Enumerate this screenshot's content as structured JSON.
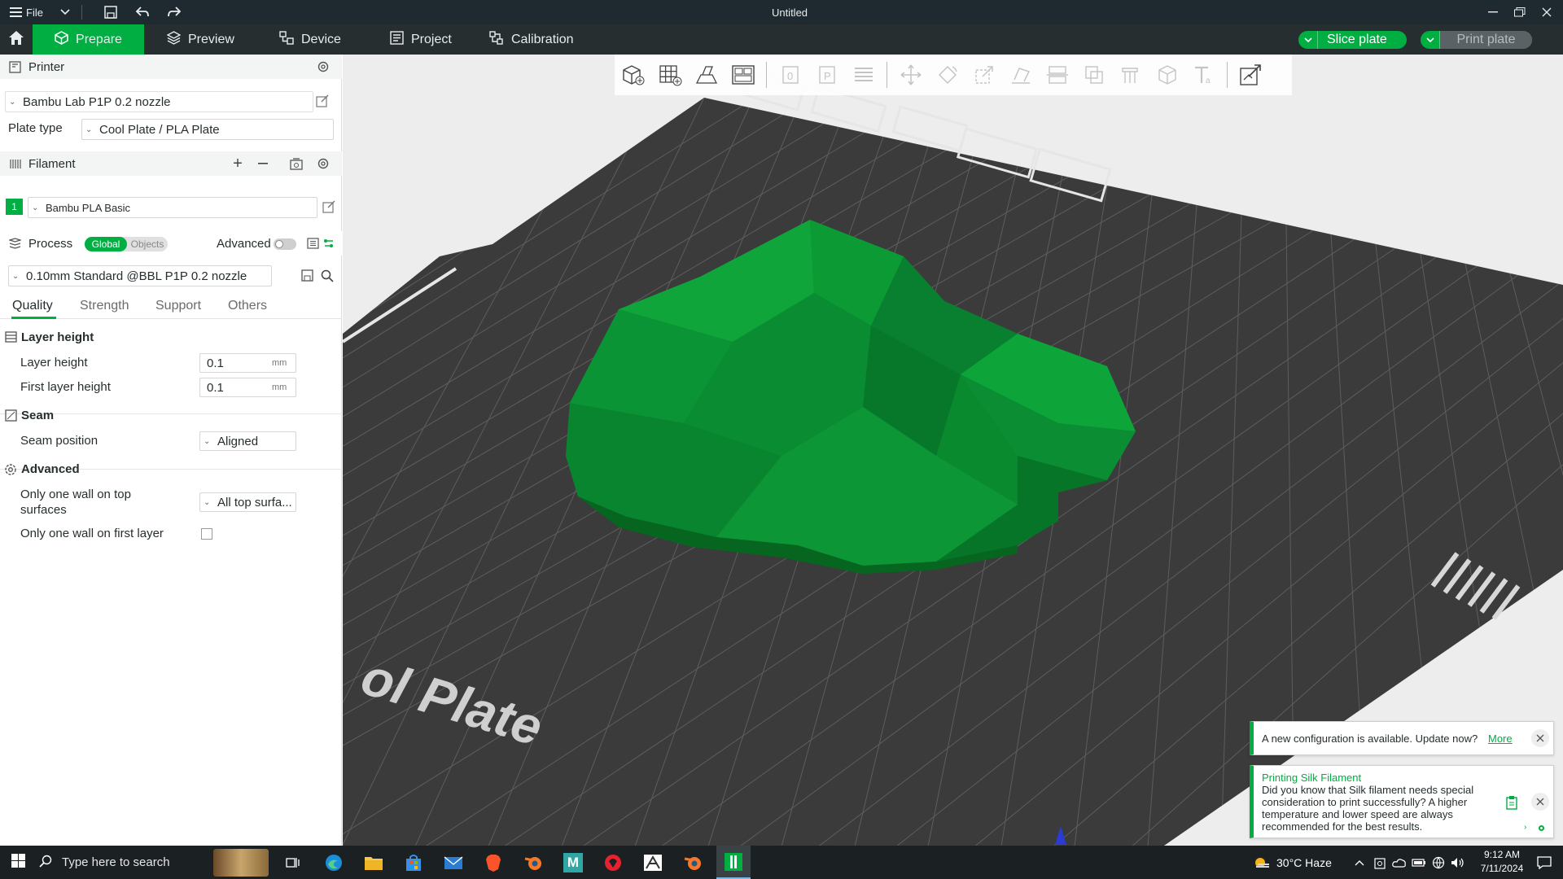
{
  "window": {
    "title": "Untitled",
    "menu_label": "File"
  },
  "tabs": [
    {
      "label": "Prepare"
    },
    {
      "label": "Preview"
    },
    {
      "label": "Device"
    },
    {
      "label": "Project"
    },
    {
      "label": "Calibration"
    }
  ],
  "actions": {
    "slice_label": "Slice plate",
    "print_label": "Print plate"
  },
  "printer": {
    "section_label": "Printer",
    "selected": "Bambu Lab P1P 0.2 nozzle",
    "plate_type_label": "Plate type",
    "plate_type_value": "Cool Plate / PLA Plate"
  },
  "filament": {
    "section_label": "Filament",
    "slot_number": "1",
    "slot_color": "#00ae42",
    "selected": "Bambu PLA Basic"
  },
  "process": {
    "section_label": "Process",
    "toggle_global": "Global",
    "toggle_objects": "Objects",
    "advanced_label": "Advanced",
    "advanced_on": false,
    "preset": "0.10mm Standard @BBL P1P 0.2 nozzle",
    "tabs": [
      {
        "label": "Quality",
        "active": true
      },
      {
        "label": "Strength"
      },
      {
        "label": "Support"
      },
      {
        "label": "Others"
      }
    ],
    "groups": {
      "layer_height": {
        "title": "Layer height",
        "layer_height_label": "Layer height",
        "layer_height_value": "0.1",
        "first_layer_label": "First layer height",
        "first_layer_value": "0.1",
        "unit": "mm"
      },
      "seam": {
        "title": "Seam",
        "position_label": "Seam position",
        "position_value": "Aligned"
      },
      "advanced": {
        "title": "Advanced",
        "top_wall_label_1": "Only one wall on top",
        "top_wall_label_2": "surfaces",
        "top_wall_value": "All top surfa...",
        "first_layer_wall_label": "Only one wall on first layer",
        "first_layer_wall_checked": false
      }
    }
  },
  "viewport": {
    "bed_label": "ol Plate",
    "model_color": "#0a8a2e",
    "bed_color": "#3a3a3a"
  },
  "notifications": {
    "config": {
      "text": "A new configuration is available. Update now?",
      "link": "More"
    },
    "tip": {
      "title": "Printing Silk Filament",
      "line1": "Did you know that Silk filament needs special",
      "line2": "consideration to print successfully? A higher",
      "line3": "temperature and lower speed are always",
      "line4": "recommended for the best results."
    }
  },
  "taskbar": {
    "search_placeholder": "Type here to search",
    "weather": "30°C  Haze",
    "time": "9:12 AM",
    "date": "7/11/2024"
  },
  "colors": {
    "accent": "#00ae42",
    "titlebar": "#1f2a30",
    "tabbar": "#262e30"
  }
}
